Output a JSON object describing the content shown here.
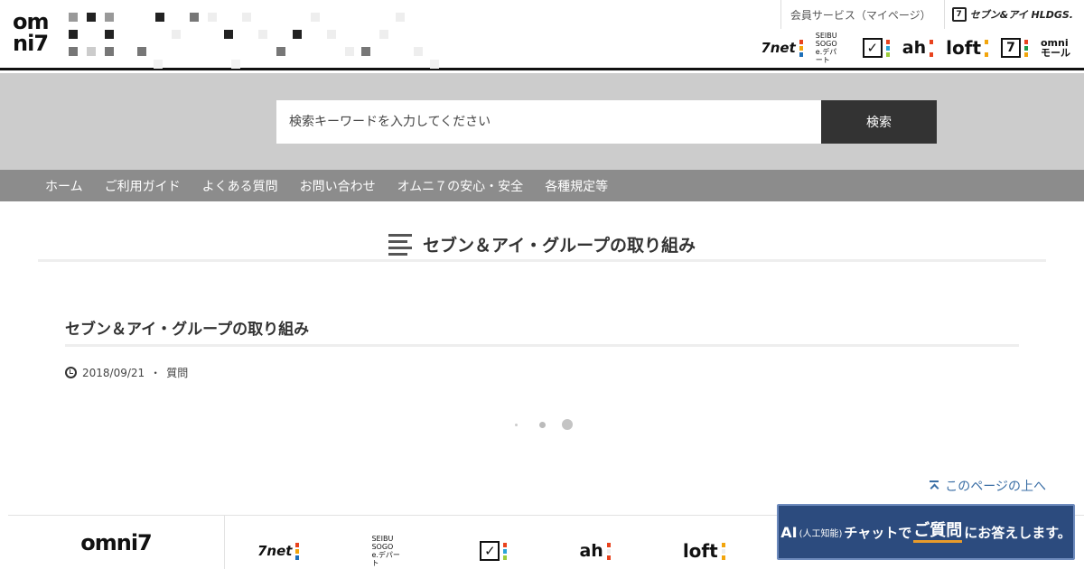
{
  "header": {
    "logo_line1": "om",
    "logo_line2": "ni7",
    "member_link": "会員サービス（マイページ）",
    "holdings_mark": "7",
    "holdings_logo": "セブン&アイ HLDGS.",
    "brands": [
      {
        "label": "7net",
        "icon": "seven-net-logo"
      },
      {
        "label": "SEIBU SOGO e.デパート",
        "icon": "seibu-sogo-logo"
      },
      {
        "label": "✓",
        "icon": "ito-yokado-logo"
      },
      {
        "label": "ah",
        "icon": "akachan-honpo-logo"
      },
      {
        "label": "loft",
        "icon": "loft-logo"
      },
      {
        "label": "7",
        "icon": "seven-eleven-logo"
      },
      {
        "label": "omni モール",
        "icon": "omni-mall-logo"
      }
    ]
  },
  "search": {
    "placeholder": "検索キーワードを入力してください",
    "button_label": "検索"
  },
  "nav": {
    "items": [
      "ホーム",
      "ご利用ガイド",
      "よくある質問",
      "お問い合わせ",
      "オムニ７の安心・安全",
      "各種規定等"
    ]
  },
  "category": {
    "title": "セブン＆アイ・グループの取り組み",
    "icon": "list-icon"
  },
  "article": {
    "title": "セブン＆アイ・グループの取り組み",
    "date": "2018/09/21",
    "separator": "・",
    "tag": "質問"
  },
  "pagetop": {
    "label": "このページの上へ"
  },
  "footer": {
    "logo": "omni7",
    "brands": [
      {
        "label": "7net"
      },
      {
        "label": "SEIBU SOGO e.デパート"
      },
      {
        "label": "✓"
      },
      {
        "label": "ah"
      },
      {
        "label": "loft"
      }
    ]
  },
  "chat": {
    "prefix": "AI",
    "paren": "(人工知能)",
    "mid": "チャットで",
    "emph": "ご質問",
    "suffix": "にお答えします。"
  },
  "colors": {
    "search_band": "#cccccc",
    "nav_bg": "#8c8c8c",
    "button_dark": "#333333",
    "link_blue": "#3a6ea5",
    "chat_bg": "#2c4b7e",
    "chat_accent": "#e89b2b"
  }
}
